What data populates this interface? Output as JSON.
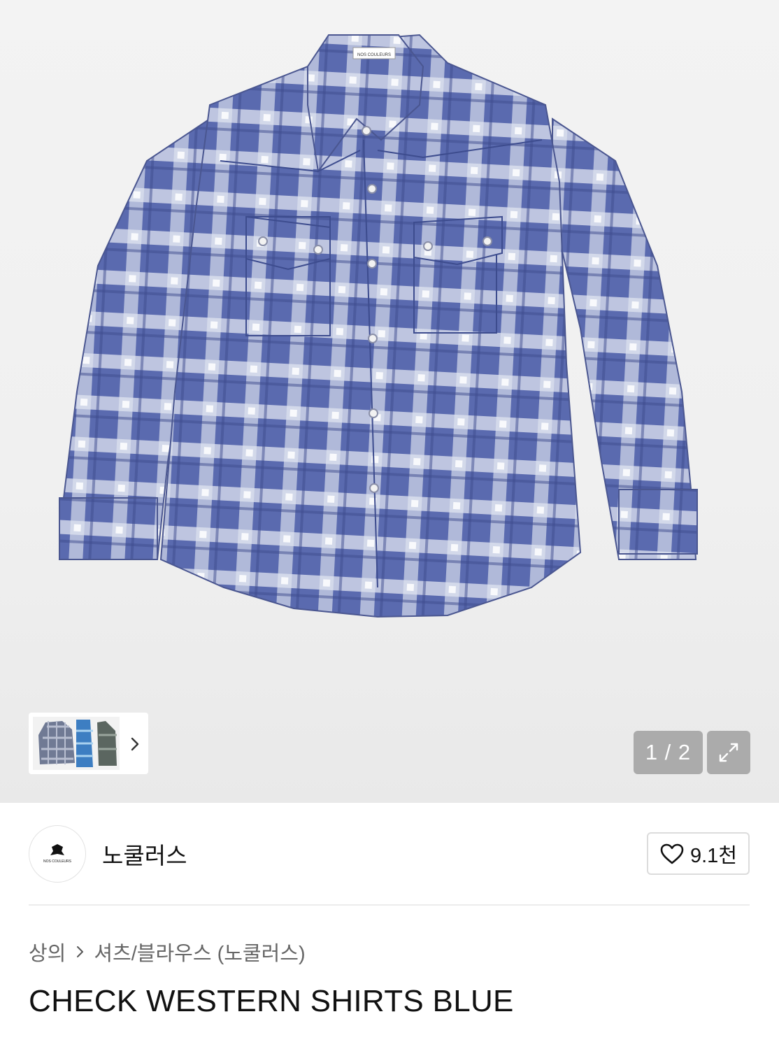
{
  "gallery": {
    "counter": "1 / 2",
    "expand_icon": "expand-icon",
    "thumbnail_more_icon": "chevron-right-icon",
    "product_label": "NOS COULEURS"
  },
  "brand": {
    "name": "노쿨러스",
    "logo_text": "NOS COULEURS",
    "like_count": "9.1천",
    "like_icon": "heart-outline-icon"
  },
  "breadcrumb": {
    "items": [
      "상의",
      "셔츠/블라우스 (노쿨러스)"
    ],
    "separator_icon": "chevron-right-icon"
  },
  "product": {
    "title": "CHECK WESTERN SHIRTS BLUE"
  },
  "colors": {
    "shirt_blue": "#5566aa",
    "check_light": "#e8ebf4",
    "overlay_gray": "#969696"
  }
}
